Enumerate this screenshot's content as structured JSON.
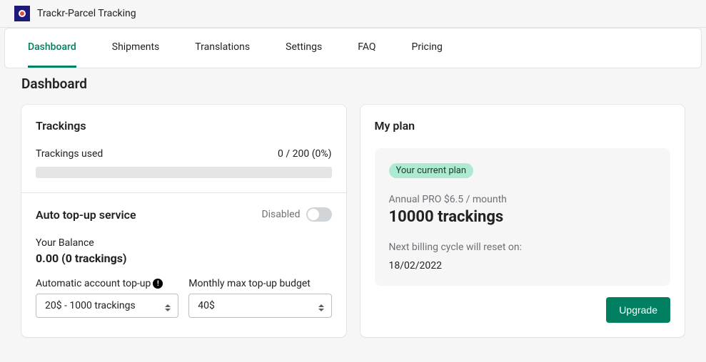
{
  "app": {
    "title": "Trackr-Parcel Tracking"
  },
  "nav": {
    "tabs": [
      {
        "label": "Dashboard",
        "active": true
      },
      {
        "label": "Shipments"
      },
      {
        "label": "Translations"
      },
      {
        "label": "Settings"
      },
      {
        "label": "FAQ"
      },
      {
        "label": "Pricing"
      }
    ]
  },
  "page": {
    "heading": "Dashboard"
  },
  "trackings": {
    "title": "Trackings",
    "used_label": "Trackings used",
    "used_value": "0 / 200 (0%)"
  },
  "topup": {
    "title": "Auto top-up service",
    "state_label": "Disabled",
    "balance_label": "Your Balance",
    "balance_value": "0.00 (0 trackings)",
    "auto_label": "Automatic account top-up",
    "auto_select": "20$ - 1000 trackings",
    "budget_label": "Monthly max top-up budget",
    "budget_select": "40$"
  },
  "plan": {
    "title": "My plan",
    "badge": "Your current plan",
    "sub": "Annual PRO $6.5 / mounth",
    "main": "10000 trackings",
    "note": "Next billing cycle will reset on:",
    "date": "18/02/2022",
    "upgrade": "Upgrade"
  }
}
